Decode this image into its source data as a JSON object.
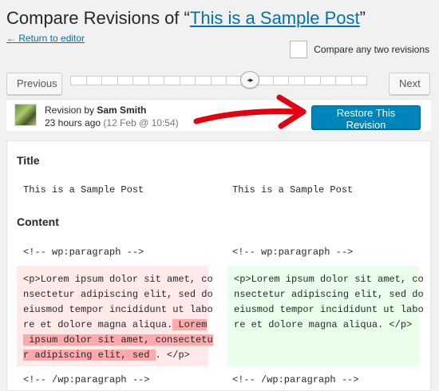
{
  "header": {
    "title_prefix": "Compare Revisions of “",
    "title_link": "This is a Sample Post",
    "title_suffix": "”",
    "back_link": "← Return to editor",
    "compare_two_label": "Compare any two revisions"
  },
  "navigation": {
    "previous_label": "Previous",
    "next_label": "Next",
    "handle_glyph": "◂▸"
  },
  "revision": {
    "author_prefix": "Revision by ",
    "author_name": "Sam Smith",
    "time_ago": "23 hours ago",
    "date": "(12 Feb @ 10:54)",
    "restore_label": "Restore This Revision"
  },
  "diff": {
    "title_heading": "Title",
    "title_left": "This is a Sample Post",
    "title_right": "This is a Sample Post",
    "content_heading": "Content",
    "comment_open_left": "<!-- wp:paragraph -->",
    "comment_open_right": "<!-- wp:paragraph -->",
    "removed_lines": [
      "<p>Lorem ipsum dolor sit amet, co",
      "nsectetur adipiscing elit, sed do",
      "eiusmod tempor incididunt ut labo",
      "re et dolore magna aliqua."
    ],
    "removed_highlight": [
      " Lorem",
      " ipsum dolor sit amet, consectetu",
      "r adipiscing elit, sed ",
      ". </p>"
    ],
    "added_lines": [
      "<p>Lorem ipsum dolor sit amet, co",
      "nsectetur adipiscing elit, sed do",
      "eiusmod tempor incididunt ut labo",
      "re et dolore magna aliqua. </p>"
    ],
    "comment_close_left": "<!-- /wp:paragraph -->",
    "comment_close_right": "<!-- /wp:paragraph -->"
  },
  "colors": {
    "accent": "#0085ba",
    "link": "#0073aa",
    "removed_bg": "#ffe9e9",
    "removed_highlight": "#ffaaaa",
    "added_bg": "#e9ffe9",
    "arrow": "#e3000f"
  },
  "icons": {
    "slider_handle": "arrows-left-right-icon",
    "annotation": "red-arrow-icon",
    "avatar": "user-avatar"
  }
}
